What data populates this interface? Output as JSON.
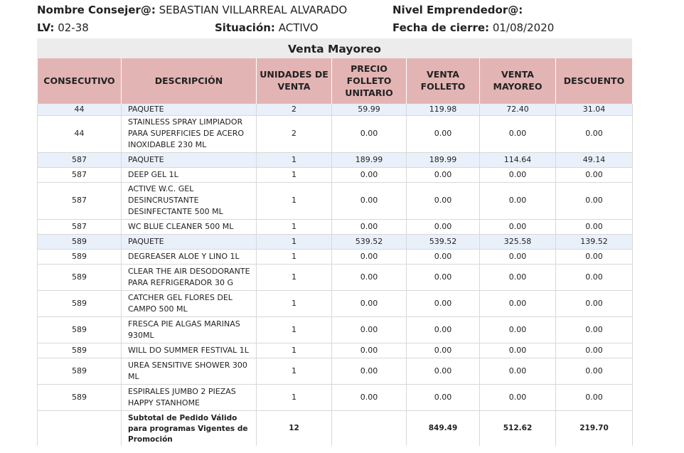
{
  "header": {
    "nombre_label": "Nombre Consejer@:",
    "nombre_value": "SEBASTIAN VILLARREAL ALVARADO",
    "nivel_label": "Nivel Emprendedor@:",
    "nivel_value": "",
    "lv_label": "LV:",
    "lv_value": "02-38",
    "situacion_label": "Situación:",
    "situacion_value": "ACTIVO",
    "fecha_label": "Fecha de cierre:",
    "fecha_value": "01/08/2020"
  },
  "section_title": "Venta Mayoreo",
  "columns": [
    "CONSECUTIVO",
    "DESCRIPCIÓN",
    "UNIDADES DE VENTA",
    "PRECIO FOLLETO UNITARIO",
    "VENTA FOLLETO",
    "VENTA MAYOREO",
    "DESCUENTO"
  ],
  "rows": [
    {
      "consecutivo": "44",
      "descripcion": "PAQUETE",
      "unidades": "2",
      "precio": "59.99",
      "venta_folleto": "119.98",
      "venta_mayoreo": "72.40",
      "descuento": "31.04",
      "highlight": true
    },
    {
      "consecutivo": "44",
      "descripcion": "STAINLESS SPRAY LIMPIADOR PARA SUPERFICIES DE ACERO INOXIDABLE 230 ML",
      "unidades": "2",
      "precio": "0.00",
      "venta_folleto": "0.00",
      "venta_mayoreo": "0.00",
      "descuento": "0.00",
      "highlight": false
    },
    {
      "consecutivo": "587",
      "descripcion": "PAQUETE",
      "unidades": "1",
      "precio": "189.99",
      "venta_folleto": "189.99",
      "venta_mayoreo": "114.64",
      "descuento": "49.14",
      "highlight": true
    },
    {
      "consecutivo": "587",
      "descripcion": "DEEP GEL 1L",
      "unidades": "1",
      "precio": "0.00",
      "venta_folleto": "0.00",
      "venta_mayoreo": "0.00",
      "descuento": "0.00",
      "highlight": false
    },
    {
      "consecutivo": "587",
      "descripcion": "ACTIVE W.C. GEL DESINCRUSTANTE DESINFECTANTE 500 ML",
      "unidades": "1",
      "precio": "0.00",
      "venta_folleto": "0.00",
      "venta_mayoreo": "0.00",
      "descuento": "0.00",
      "highlight": false
    },
    {
      "consecutivo": "587",
      "descripcion": "WC BLUE CLEANER 500 ML",
      "unidades": "1",
      "precio": "0.00",
      "venta_folleto": "0.00",
      "venta_mayoreo": "0.00",
      "descuento": "0.00",
      "highlight": false
    },
    {
      "consecutivo": "589",
      "descripcion": "PAQUETE",
      "unidades": "1",
      "precio": "539.52",
      "venta_folleto": "539.52",
      "venta_mayoreo": "325.58",
      "descuento": "139.52",
      "highlight": true
    },
    {
      "consecutivo": "589",
      "descripcion": "DEGREASER ALOE Y LINO 1L",
      "unidades": "1",
      "precio": "0.00",
      "venta_folleto": "0.00",
      "venta_mayoreo": "0.00",
      "descuento": "0.00",
      "highlight": false
    },
    {
      "consecutivo": "589",
      "descripcion": "CLEAR THE AIR DESODORANTE PARA REFRIGERADOR 30 G",
      "unidades": "1",
      "precio": "0.00",
      "venta_folleto": "0.00",
      "venta_mayoreo": "0.00",
      "descuento": "0.00",
      "highlight": false
    },
    {
      "consecutivo": "589",
      "descripcion": "CATCHER GEL FLORES DEL CAMPO 500 ML",
      "unidades": "1",
      "precio": "0.00",
      "venta_folleto": "0.00",
      "venta_mayoreo": "0.00",
      "descuento": "0.00",
      "highlight": false
    },
    {
      "consecutivo": "589",
      "descripcion": "FRESCA PIE ALGAS MARINAS 930ML",
      "unidades": "1",
      "precio": "0.00",
      "venta_folleto": "0.00",
      "venta_mayoreo": "0.00",
      "descuento": "0.00",
      "highlight": false
    },
    {
      "consecutivo": "589",
      "descripcion": "WILL DO SUMMER FESTIVAL 1L",
      "unidades": "1",
      "precio": "0.00",
      "venta_folleto": "0.00",
      "venta_mayoreo": "0.00",
      "descuento": "0.00",
      "highlight": false
    },
    {
      "consecutivo": "589",
      "descripcion": "UREA SENSITIVE SHOWER 300 ML",
      "unidades": "1",
      "precio": "0.00",
      "venta_folleto": "0.00",
      "venta_mayoreo": "0.00",
      "descuento": "0.00",
      "highlight": false
    },
    {
      "consecutivo": "589",
      "descripcion": "ESPIRALES JUMBO 2 PIEZAS HAPPY STANHOME",
      "unidades": "1",
      "precio": "0.00",
      "venta_folleto": "0.00",
      "venta_mayoreo": "0.00",
      "descuento": "0.00",
      "highlight": false
    }
  ],
  "subtotal": {
    "label": "Subtotal de Pedido Válido para programas Vigentes de Promoción",
    "unidades": "12",
    "precio": "",
    "venta_folleto": "849.49",
    "venta_mayoreo": "512.62",
    "descuento": "219.70"
  },
  "colors": {
    "header_bg": "#e3b4b4",
    "title_bg": "#ececec",
    "highlight_row": "#eaf0fa"
  }
}
